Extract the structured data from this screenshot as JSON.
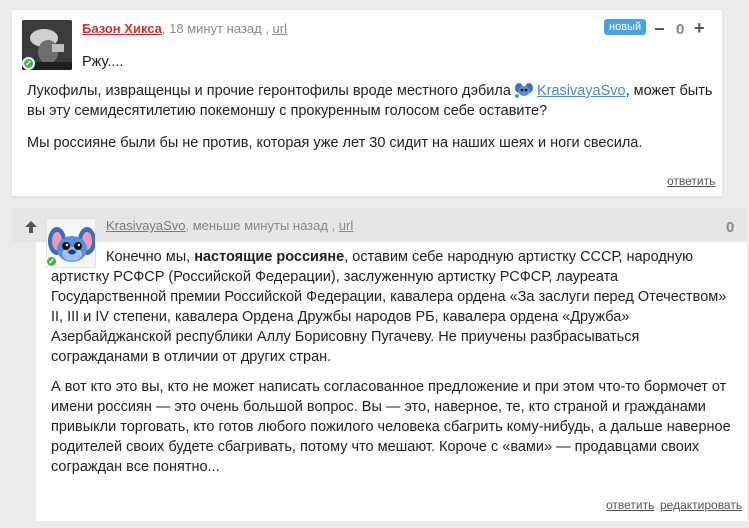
{
  "comment1": {
    "author": "Базон Хикса",
    "time": "18 минут назад",
    "url_label": "url",
    "new_label": "новый",
    "vote_minus": "−",
    "vote_plus": "+",
    "score": "0",
    "paragraphs": {
      "p1": "Ржу....",
      "p2_before": "Лукофилы, извращенцы и прочие геронтофилы вроде местного дэбила",
      "p2_mention": "KrasivayaSvo",
      "p2_after": ",   может быть вы эту семидесятилетию покемоншу с прокуренным голосом себе оставите?",
      "p3": "Мы россияне были бы не против, которая уже лет 30 сидит на наших шеях и ноги свесила."
    },
    "reply_label": "ответить"
  },
  "comment2": {
    "author": "KrasivayaSvo",
    "time": "меньше минуты назад",
    "url_label": "url",
    "score": "0",
    "paragraphs": {
      "p1_before": "Конечно мы,",
      "p1_bold": "настоящие россияне",
      "p1_after": ", оставим себе народную артистку СССР, народную артистку РСФСР (Российской Федерации), заслуженную артистку РСФСР, лауреата Государственной премии Российской Федерации, кавалера ордена «За заслуги перед Отечеством» II, III и IV степени, кавалера Ордена Дружбы народов РБ, кавалера ордена «Дружба» Азербайджанской республики Аллу Борисовну Пугачеву. Не приучены разбрасываться согражданами в отличии от других стран.",
      "p2": "А вот кто это вы, кто не может написать согласованное предложение и при этом что-то бормочет от имени россиян — это очень большой вопрос. Вы — это, наверное, те, кто страной и гражданами привыкли торговать, кто готов любого пожилого человека сбагрить кому-нибудь, а дальше наверное родителей своих будете сбагривать, потому что мешают. Короче с «вами» — продавцами своих сограждан все понятно..."
    },
    "reply_label": "ответить",
    "edit_label": "редактировать"
  }
}
